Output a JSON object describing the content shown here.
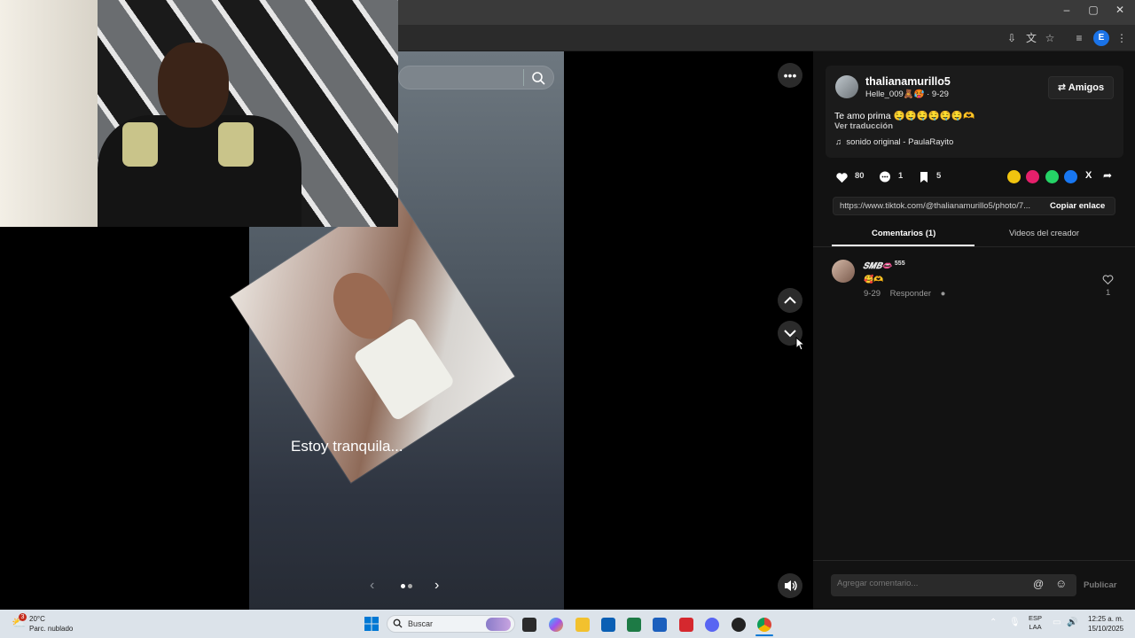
{
  "browser": {
    "window_controls": {
      "minimize": "–",
      "restore": "▢",
      "close": "✕"
    },
    "profile_initial": "E"
  },
  "post": {
    "username": "thalianamurillo5",
    "display_name": "Helle_009🧸🥵",
    "date": "9-29",
    "follow_button": "Amigos",
    "description": "Te amo prima 🤤🤤🤤🤤🤤🤤🫶",
    "translate_link": "Ver traducción",
    "music": "sonido original - PaulaRayito",
    "likes": "80",
    "comments": "1",
    "saves": "5",
    "link": "https://www.tiktok.com/@thalianamurillo5/photo/7...",
    "copy_link": "Copiar enlace",
    "photo_caption": "Estoy tranquila..."
  },
  "tabs": [
    {
      "label": "Comentarios (1)",
      "active": true
    },
    {
      "label": "Videos del creador",
      "active": false
    }
  ],
  "comments": [
    {
      "user": "𝑺𝑴𝑩👄",
      "badge": "555",
      "text": "🥰🫶",
      "date": "9-29",
      "reply": "Responder",
      "likes": "1"
    }
  ],
  "composer": {
    "placeholder": "Agregar comentario...",
    "publish": "Publicar"
  },
  "taskbar": {
    "weather_temp": "20°C",
    "weather_desc": "Parc. nublado",
    "weather_badge": "3",
    "search_placeholder": "Buscar",
    "lang_1": "ESP",
    "lang_2": "LAA",
    "time": "12:25 a. m.",
    "date": "15/10/2025"
  },
  "colors": {
    "panel_bg": "#121212",
    "taskbar_bg": "#dce3ea",
    "link_blue": "#1a73e8"
  }
}
